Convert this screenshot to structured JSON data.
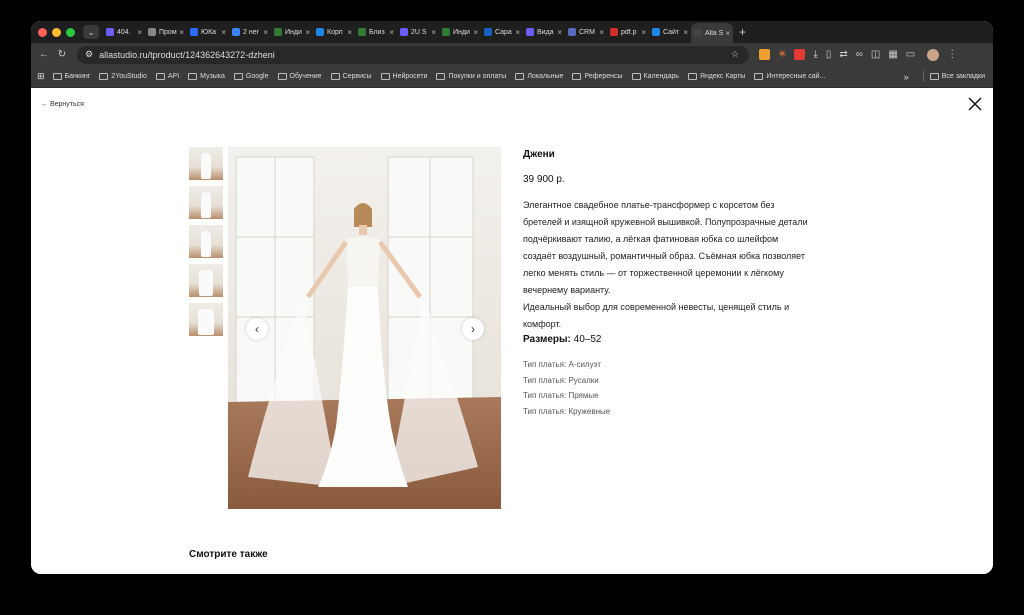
{
  "browser": {
    "tabs": [
      {
        "label": "404.",
        "color": "#6b5cff"
      },
      {
        "label": "Пром",
        "color": "#888888"
      },
      {
        "label": "ЮКа",
        "color": "#2b6cff"
      },
      {
        "label": "2 нег",
        "color": "#3b82f6"
      },
      {
        "label": "Инди",
        "color": "#2e7d32"
      },
      {
        "label": "Корп",
        "color": "#1e88e5"
      },
      {
        "label": "Близ",
        "color": "#2e7d32"
      },
      {
        "label": "2U S",
        "color": "#6b5cff"
      },
      {
        "label": "Инди",
        "color": "#2e7d32"
      },
      {
        "label": "Сара",
        "color": "#1565c0"
      },
      {
        "label": "Вида",
        "color": "#6b5cff"
      },
      {
        "label": "CRM",
        "color": "#5c6bc0"
      },
      {
        "label": "pdf.p",
        "color": "#d32f2f"
      },
      {
        "label": "Сайт",
        "color": "#1e88e5"
      },
      {
        "label": "Alla S",
        "color": "#444444"
      }
    ],
    "tab_close": "×",
    "new_tab": "+",
    "url": "allastudio.ru/tproduct/124362643272-dzheni",
    "bookmarks": [
      "Банкинг",
      "2YouStudio",
      "API",
      "Музыка",
      "Google",
      "Обучение",
      "Сервисы",
      "Нейросети",
      "Покупки и оплаты",
      "Локальные",
      "Референсы",
      "Календарь",
      "Яндекс Карты",
      "Интересные сай..."
    ],
    "bookmarks_more": "»",
    "all_bookmarks": "Все закладки"
  },
  "page": {
    "back": "← Вернуться",
    "product": {
      "name": "Джени",
      "price": "39 900 р.",
      "description_lines": [
        "Элегантное свадебное платье-трансформер с корсетом без",
        "бретелей и изящной кружевной вышивкой. Полупрозрачные детали",
        "подчёркивают талию, а лёгкая фатиновая юбка со шлейфом",
        "создаёт воздушный, романтичный образ. Съёмная юбка позволяет",
        "легко менять стиль — от торжественной церемонии к лёгкому",
        "вечернему варианту.",
        "Идеальный выбор для современной невесты, ценящей стиль и",
        "комфорт."
      ],
      "sizes_label": "Размеры:",
      "sizes_value": "40–52",
      "types": [
        "Тип платья: А-силуэт",
        "Тип платья: Русалки",
        "Тип платья: Прямые",
        "Тип платья: Кружевные"
      ]
    },
    "see_also": "Смотрите также"
  }
}
